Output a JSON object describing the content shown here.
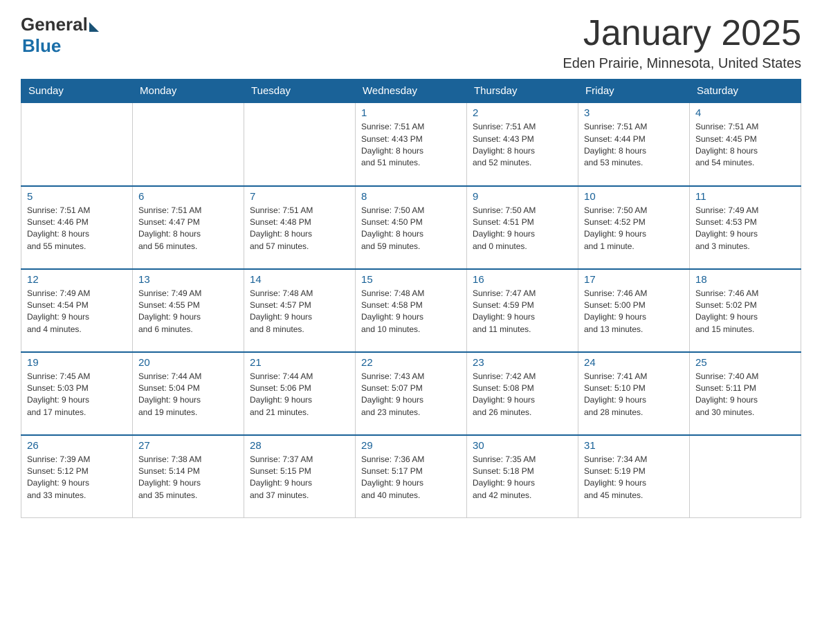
{
  "header": {
    "logo_general": "General",
    "logo_blue": "Blue",
    "month_title": "January 2025",
    "location": "Eden Prairie, Minnesota, United States"
  },
  "days_of_week": [
    "Sunday",
    "Monday",
    "Tuesday",
    "Wednesday",
    "Thursday",
    "Friday",
    "Saturday"
  ],
  "weeks": [
    [
      {
        "day": "",
        "info": ""
      },
      {
        "day": "",
        "info": ""
      },
      {
        "day": "",
        "info": ""
      },
      {
        "day": "1",
        "info": "Sunrise: 7:51 AM\nSunset: 4:43 PM\nDaylight: 8 hours\nand 51 minutes."
      },
      {
        "day": "2",
        "info": "Sunrise: 7:51 AM\nSunset: 4:43 PM\nDaylight: 8 hours\nand 52 minutes."
      },
      {
        "day": "3",
        "info": "Sunrise: 7:51 AM\nSunset: 4:44 PM\nDaylight: 8 hours\nand 53 minutes."
      },
      {
        "day": "4",
        "info": "Sunrise: 7:51 AM\nSunset: 4:45 PM\nDaylight: 8 hours\nand 54 minutes."
      }
    ],
    [
      {
        "day": "5",
        "info": "Sunrise: 7:51 AM\nSunset: 4:46 PM\nDaylight: 8 hours\nand 55 minutes."
      },
      {
        "day": "6",
        "info": "Sunrise: 7:51 AM\nSunset: 4:47 PM\nDaylight: 8 hours\nand 56 minutes."
      },
      {
        "day": "7",
        "info": "Sunrise: 7:51 AM\nSunset: 4:48 PM\nDaylight: 8 hours\nand 57 minutes."
      },
      {
        "day": "8",
        "info": "Sunrise: 7:50 AM\nSunset: 4:50 PM\nDaylight: 8 hours\nand 59 minutes."
      },
      {
        "day": "9",
        "info": "Sunrise: 7:50 AM\nSunset: 4:51 PM\nDaylight: 9 hours\nand 0 minutes."
      },
      {
        "day": "10",
        "info": "Sunrise: 7:50 AM\nSunset: 4:52 PM\nDaylight: 9 hours\nand 1 minute."
      },
      {
        "day": "11",
        "info": "Sunrise: 7:49 AM\nSunset: 4:53 PM\nDaylight: 9 hours\nand 3 minutes."
      }
    ],
    [
      {
        "day": "12",
        "info": "Sunrise: 7:49 AM\nSunset: 4:54 PM\nDaylight: 9 hours\nand 4 minutes."
      },
      {
        "day": "13",
        "info": "Sunrise: 7:49 AM\nSunset: 4:55 PM\nDaylight: 9 hours\nand 6 minutes."
      },
      {
        "day": "14",
        "info": "Sunrise: 7:48 AM\nSunset: 4:57 PM\nDaylight: 9 hours\nand 8 minutes."
      },
      {
        "day": "15",
        "info": "Sunrise: 7:48 AM\nSunset: 4:58 PM\nDaylight: 9 hours\nand 10 minutes."
      },
      {
        "day": "16",
        "info": "Sunrise: 7:47 AM\nSunset: 4:59 PM\nDaylight: 9 hours\nand 11 minutes."
      },
      {
        "day": "17",
        "info": "Sunrise: 7:46 AM\nSunset: 5:00 PM\nDaylight: 9 hours\nand 13 minutes."
      },
      {
        "day": "18",
        "info": "Sunrise: 7:46 AM\nSunset: 5:02 PM\nDaylight: 9 hours\nand 15 minutes."
      }
    ],
    [
      {
        "day": "19",
        "info": "Sunrise: 7:45 AM\nSunset: 5:03 PM\nDaylight: 9 hours\nand 17 minutes."
      },
      {
        "day": "20",
        "info": "Sunrise: 7:44 AM\nSunset: 5:04 PM\nDaylight: 9 hours\nand 19 minutes."
      },
      {
        "day": "21",
        "info": "Sunrise: 7:44 AM\nSunset: 5:06 PM\nDaylight: 9 hours\nand 21 minutes."
      },
      {
        "day": "22",
        "info": "Sunrise: 7:43 AM\nSunset: 5:07 PM\nDaylight: 9 hours\nand 23 minutes."
      },
      {
        "day": "23",
        "info": "Sunrise: 7:42 AM\nSunset: 5:08 PM\nDaylight: 9 hours\nand 26 minutes."
      },
      {
        "day": "24",
        "info": "Sunrise: 7:41 AM\nSunset: 5:10 PM\nDaylight: 9 hours\nand 28 minutes."
      },
      {
        "day": "25",
        "info": "Sunrise: 7:40 AM\nSunset: 5:11 PM\nDaylight: 9 hours\nand 30 minutes."
      }
    ],
    [
      {
        "day": "26",
        "info": "Sunrise: 7:39 AM\nSunset: 5:12 PM\nDaylight: 9 hours\nand 33 minutes."
      },
      {
        "day": "27",
        "info": "Sunrise: 7:38 AM\nSunset: 5:14 PM\nDaylight: 9 hours\nand 35 minutes."
      },
      {
        "day": "28",
        "info": "Sunrise: 7:37 AM\nSunset: 5:15 PM\nDaylight: 9 hours\nand 37 minutes."
      },
      {
        "day": "29",
        "info": "Sunrise: 7:36 AM\nSunset: 5:17 PM\nDaylight: 9 hours\nand 40 minutes."
      },
      {
        "day": "30",
        "info": "Sunrise: 7:35 AM\nSunset: 5:18 PM\nDaylight: 9 hours\nand 42 minutes."
      },
      {
        "day": "31",
        "info": "Sunrise: 7:34 AM\nSunset: 5:19 PM\nDaylight: 9 hours\nand 45 minutes."
      },
      {
        "day": "",
        "info": ""
      }
    ]
  ]
}
